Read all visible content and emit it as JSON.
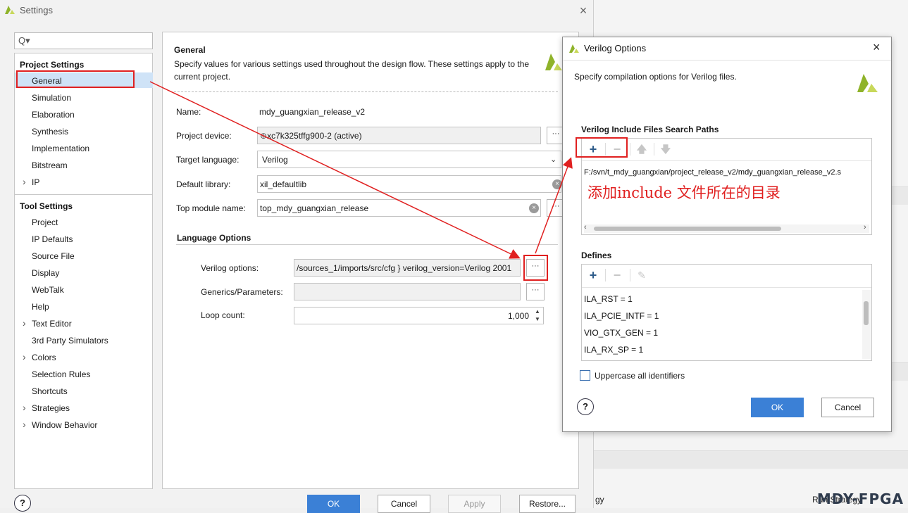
{
  "settings": {
    "title": "Settings",
    "search_icon_glyph": "Q▾",
    "sections": {
      "project": "Project Settings",
      "tool": "Tool Settings"
    },
    "project_items": [
      "General",
      "Simulation",
      "Elaboration",
      "Synthesis",
      "Implementation",
      "Bitstream",
      "IP"
    ],
    "tool_items": [
      "Project",
      "IP Defaults",
      "Source File",
      "Display",
      "WebTalk",
      "Help",
      "Text Editor",
      "3rd Party Simulators",
      "Colors",
      "Selection Rules",
      "Shortcuts",
      "Strategies",
      "Window Behavior"
    ],
    "selected_item": "General",
    "content": {
      "title": "General",
      "description": "Specify values for various settings used throughout the design flow. These settings apply to the current project.",
      "name_label": "Name:",
      "name_value": "mdy_guangxian_release_v2",
      "device_label": "Project device:",
      "device_value": "xc7k325tffg900-2 (active)",
      "target_lang_label": "Target language:",
      "target_lang_value": "Verilog",
      "default_lib_label": "Default library:",
      "default_lib_value": "xil_defaultlib",
      "top_module_label": "Top module name:",
      "top_module_value": "top_mdy_guangxian_release",
      "lang_options_title": "Language Options",
      "verilog_options_label": "Verilog options:",
      "verilog_options_value": "/sources_1/imports/src/cfg } verilog_version=Verilog 2001",
      "generics_label": "Generics/Parameters:",
      "generics_value": "",
      "loop_count_label": "Loop count:",
      "loop_count_value": "1,000",
      "dots": "···"
    },
    "buttons": {
      "ok": "OK",
      "cancel": "Cancel",
      "apply": "Apply",
      "restore": "Restore..."
    },
    "help_glyph": "?"
  },
  "verilog_dialog": {
    "title": "Verilog Options",
    "description": "Specify compilation options for Verilog files.",
    "include_title": "Verilog Include Files Search Paths",
    "include_paths": [
      "F:/svn/t_mdy_guangxian/project_release_v2/mdy_guangxian_release_v2.s"
    ],
    "defines_title": "Defines",
    "defines": [
      "ILA_RST = 1",
      "ILA_PCIE_INTF = 1",
      "VIO_GTX_GEN = 1",
      "ILA_RX_SP = 1"
    ],
    "uppercase_label": "Uppercase all identifiers",
    "uppercase_checked": false,
    "ok": "OK",
    "cancel": "Cancel",
    "help_glyph": "?"
  },
  "annotation": {
    "text": "添加include 文件所在的目录"
  },
  "background": {
    "bottom_left_text": "gy",
    "bottom_right_text": "Run Strategy",
    "watermark": "MDY-FPGA"
  },
  "colors": {
    "accent": "#3b80d6",
    "selection": "#cfe3f7",
    "annotation_red": "#e02020",
    "xilinx_logo": "#8fb32a"
  },
  "icons": [
    "xilinx-logo-icon",
    "close-icon",
    "search-icon",
    "chip-icon",
    "chevron-down-icon",
    "clear-icon",
    "plus-icon",
    "minus-icon",
    "arrow-up-icon",
    "arrow-down-icon",
    "edit-icon",
    "help-icon",
    "chevron-right-icon",
    "scrollbar"
  ]
}
